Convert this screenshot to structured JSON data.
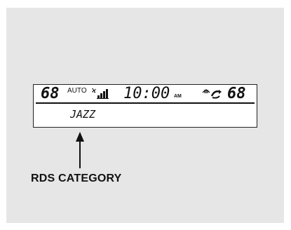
{
  "display": {
    "left_temp": "68",
    "mode": "AUTO",
    "clock": "10:00",
    "ampm": "AM",
    "right_temp": "68",
    "rds_text": "JAZZ"
  },
  "icons": {
    "fan": "fan-speed-icon",
    "defrost": "rear-defrost-icon",
    "recirc": "air-recirculation-icon"
  },
  "callout": {
    "label": "RDS CATEGORY"
  }
}
